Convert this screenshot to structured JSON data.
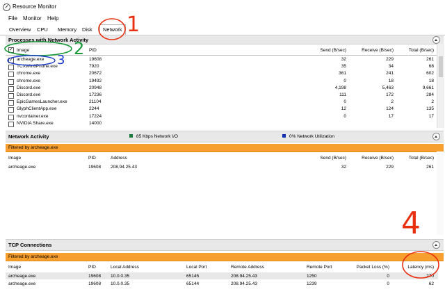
{
  "app": {
    "title": "Resource Monitor"
  },
  "menu": [
    "File",
    "Monitor",
    "Help"
  ],
  "tabs": [
    "Overview",
    "CPU",
    "Memory",
    "Disk",
    "Network"
  ],
  "processes": {
    "title": "Processes with Network Activity",
    "columns": [
      "Image",
      "PID",
      "Send (B/sec)",
      "Receive (B/sec)",
      "Total (B/sec)"
    ],
    "rows": [
      {
        "image": "archeage.exe",
        "pid": "19608",
        "send": "32",
        "recv": "229",
        "total": "261",
        "checked": true
      },
      {
        "image": "TCXWin6Phone.exe",
        "pid": "7920",
        "send": "35",
        "recv": "34",
        "total": "68",
        "checked": false
      },
      {
        "image": "chrome.exe",
        "pid": "20672",
        "send": "361",
        "recv": "241",
        "total": "602",
        "checked": false
      },
      {
        "image": "chrome.exe",
        "pid": "19492",
        "send": "0",
        "recv": "18",
        "total": "18",
        "checked": false
      },
      {
        "image": "Discord.exe",
        "pid": "20948",
        "send": "4,198",
        "recv": "5,463",
        "total": "9,661",
        "checked": false
      },
      {
        "image": "Discord.exe",
        "pid": "17236",
        "send": "111",
        "recv": "172",
        "total": "284",
        "checked": false
      },
      {
        "image": "EpicGamesLauncher.exe",
        "pid": "21104",
        "send": "0",
        "recv": "2",
        "total": "2",
        "checked": false
      },
      {
        "image": "GlyphClientApp.exe",
        "pid": "2244",
        "send": "12",
        "recv": "124",
        "total": "135",
        "checked": false
      },
      {
        "image": "nvcontainer.exe",
        "pid": "17224",
        "send": "0",
        "recv": "17",
        "total": "17",
        "checked": false
      },
      {
        "image": "NVIDIA Share.exe",
        "pid": "14000",
        "send": "",
        "recv": "",
        "total": "",
        "checked": false
      }
    ]
  },
  "network_activity": {
    "title": "Network Activity",
    "legend1": "85 Kbps Network I/O",
    "legend1_color": "#1a7a3a",
    "legend2": "0% Network Utilization",
    "legend2_color": "#1030b0",
    "filter": "Filtered by archeage.exe",
    "columns": [
      "Image",
      "PID",
      "Address",
      "Send (B/sec)",
      "Receive (B/sec)",
      "Total (B/sec)"
    ],
    "rows": [
      {
        "image": "archeage.exe",
        "pid": "19608",
        "address": "208.94.25.43",
        "send": "32",
        "recv": "229",
        "total": "261"
      }
    ]
  },
  "tcp": {
    "title": "TCP Connections",
    "filter": "Filtered by archeage.exe",
    "columns": [
      "Image",
      "PID",
      "Local Address",
      "Local Port",
      "Remote Address",
      "Remote Port",
      "Packet Loss (%)",
      "Latency (ms)"
    ],
    "rows": [
      {
        "image": "archeage.exe",
        "pid": "19608",
        "local_addr": "10.0.0.35",
        "local_port": "65145",
        "remote_addr": "208.94.25.43",
        "remote_port": "1250",
        "loss": "0",
        "latency": "270"
      },
      {
        "image": "archeage.exe",
        "pid": "19608",
        "local_addr": "10.0.0.35",
        "local_port": "65144",
        "remote_addr": "208.94.25.43",
        "remote_port": "1239",
        "loss": "0",
        "latency": "62"
      }
    ]
  },
  "annotations": {
    "n1": "1",
    "n2": "2",
    "n3": "3",
    "n4": "4",
    "color_red": "#e83010",
    "color_green": "#1a9a3a",
    "color_blue": "#1a3acc"
  }
}
